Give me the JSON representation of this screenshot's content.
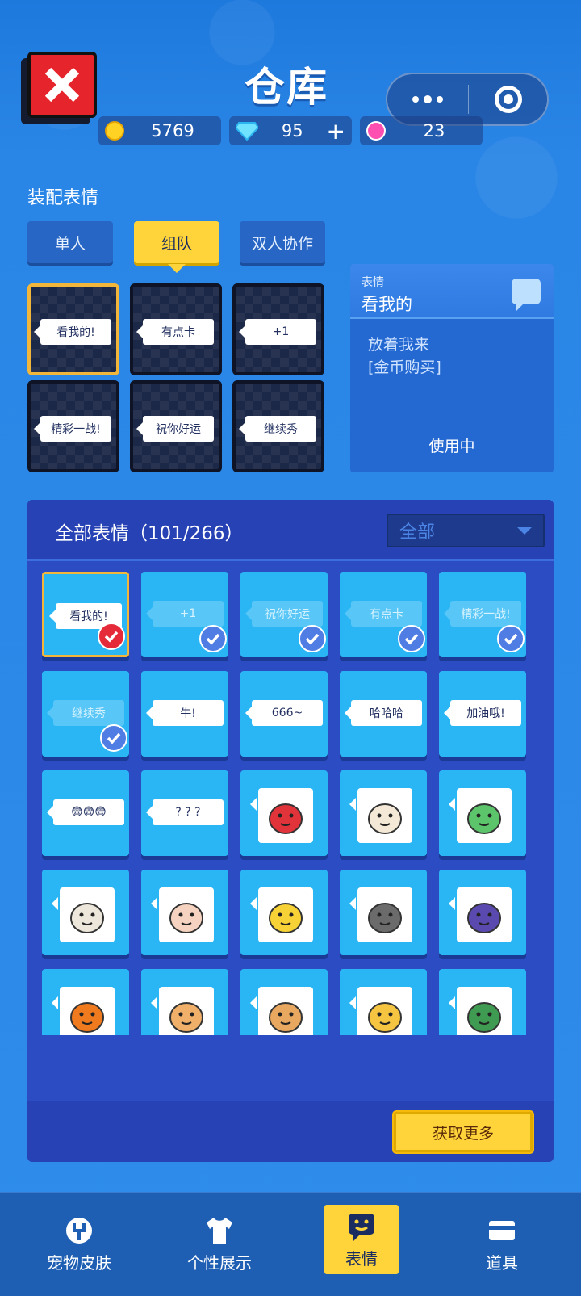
{
  "header": {
    "title": "仓库",
    "close_icon": "close-icon",
    "currencies": [
      {
        "name": "coin",
        "value": "5769"
      },
      {
        "name": "diamond",
        "value": "95",
        "plus": "+"
      },
      {
        "name": "lotus",
        "value": "23"
      }
    ]
  },
  "equip": {
    "label": "装配表情",
    "tabs": [
      "单人",
      "组队",
      "双人协作"
    ],
    "active_tab": "组队",
    "slots": [
      "看我的!",
      "有点卡",
      "+1",
      "精彩一战!",
      "祝你好运",
      "继续秀"
    ]
  },
  "detail": {
    "type_label": "表情",
    "name": "看我的",
    "desc_line1": "放着我来",
    "desc_line2": "[金币购买]",
    "status": "使用中"
  },
  "collection": {
    "title": "全部表情（101/266）",
    "filter": "全部",
    "text_items": [
      {
        "label": "看我的!",
        "state": "selected"
      },
      {
        "label": "+1",
        "state": "equipped"
      },
      {
        "label": "祝你好运",
        "state": "equipped"
      },
      {
        "label": "有点卡",
        "state": "equipped"
      },
      {
        "label": "精彩一战!",
        "state": "equipped"
      },
      {
        "label": "继续秀",
        "state": "equipped"
      },
      {
        "label": "牛!",
        "state": "normal"
      },
      {
        "label": "666~",
        "state": "normal"
      },
      {
        "label": "哈哈哈",
        "state": "normal"
      },
      {
        "label": "加油哦!",
        "state": "normal"
      },
      {
        "label": "😨😨😨",
        "state": "normal"
      },
      {
        "label": "? ? ?",
        "state": "normal"
      }
    ],
    "stickers": [
      "fire-rooster-sticker",
      "rabbit-sticker",
      "dinosaur-sticker",
      "sheep-sticker",
      "rock-hand-sticker",
      "chick-sticker",
      "bull-sticker",
      "wizard-hat-sticker",
      "pumpkin-sticker",
      "shiba-sticker",
      "shiba-sticker-2",
      "jester-sticker",
      "mochi-sticker"
    ],
    "get_more": "获取更多"
  },
  "nav": [
    {
      "label": "宠物皮肤",
      "icon": "pet-icon"
    },
    {
      "label": "个性展示",
      "icon": "shirt-icon"
    },
    {
      "label": "表情",
      "icon": "emoji-icon",
      "active": true
    },
    {
      "label": "道具",
      "icon": "card-icon"
    }
  ]
}
